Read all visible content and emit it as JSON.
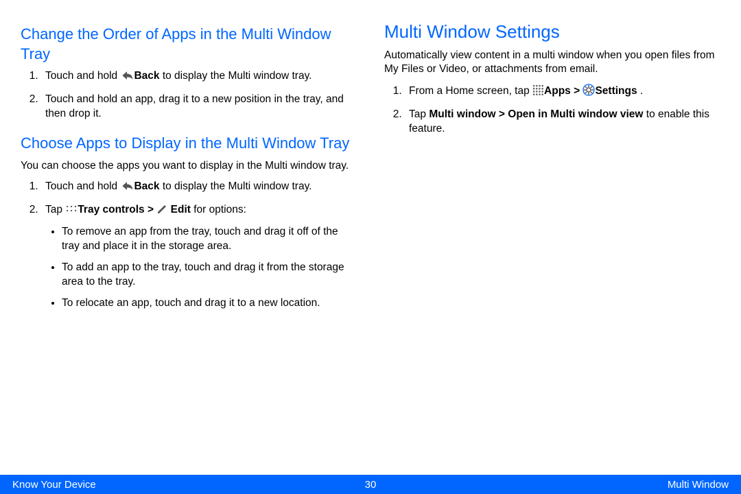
{
  "left": {
    "h2a": "Change the Order of Apps in the Multi Window Tray",
    "ol1": {
      "s1a": "Touch and hold ",
      "s1b": "Back",
      "s1c": " to display the Multi window tray.",
      "s2": "Touch and hold an app, drag it to a new position in the tray, and then drop it."
    },
    "h2b": "Choose Apps to Display in the Multi Window Tray",
    "p1": "You can choose the apps you want to display in the Multi window tray.",
    "ol2": {
      "s1a": "Touch and hold ",
      "s1b": "Back",
      "s1c": " to display the Multi window tray.",
      "s2a": "Tap ",
      "s2b": "Tray controls > ",
      "s2c": " Edit",
      "s2d": " for options:",
      "b1": "To remove an app from the tray, touch and drag it off of the tray and place it in the storage area.",
      "b2": "To add an app to the tray, touch and drag it from the storage area to the tray.",
      "b3": "To relocate an app, touch and drag it to a new location."
    }
  },
  "right": {
    "h1": "Multi Window Settings",
    "p1": "Automatically view content in a multi window when you open files from My Files or Video, or attachments from email.",
    "ol": {
      "s1a": "From a Home screen, tap ",
      "s1b": "Apps > ",
      "s1c": "Settings",
      "s1d": " .",
      "s2a": "Tap ",
      "s2b": "Multi window > Open in Multi window view",
      "s2c": " to enable this feature."
    }
  },
  "footer": {
    "left": "Know Your Device",
    "center": "30",
    "right": "Multi Window"
  }
}
